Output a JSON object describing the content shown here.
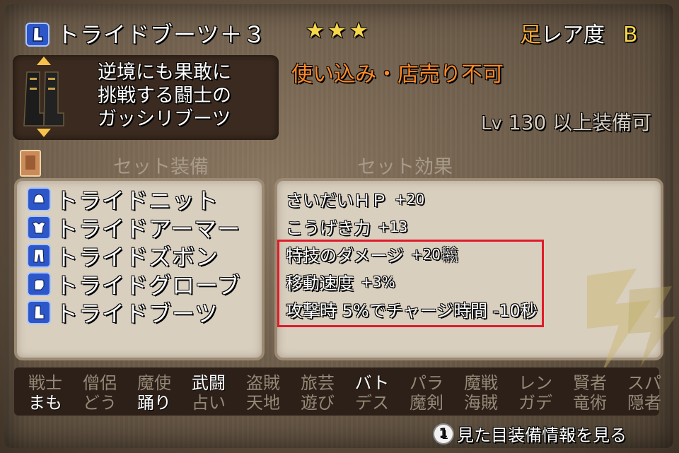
{
  "header": {
    "item_name": "トライドブーツ＋３",
    "stars": "★★★",
    "rarity_slot": "足",
    "rarity_label": "レア度",
    "rarity_grade": "B"
  },
  "description": {
    "line1": "逆境にも果敢に",
    "line2": "挑戦する闘士の",
    "line3": "ガッシリブーツ"
  },
  "restriction": "使い込み・店売り不可",
  "level": {
    "prefix": "Lv",
    "value": "130",
    "suffix": "以上装備可"
  },
  "set_section": {
    "equip_title": "セット装備",
    "effect_title": "セット効果"
  },
  "set_items": [
    {
      "label": "トライドニット",
      "icon": "helmet-icon"
    },
    {
      "label": "トライドアーマー",
      "icon": "armor-icon"
    },
    {
      "label": "トライドズボン",
      "icon": "pants-icon"
    },
    {
      "label": "トライドグローブ",
      "icon": "glove-icon"
    },
    {
      "label": "トライドブーツ",
      "icon": "boots-icon"
    }
  ],
  "set_effects": [
    {
      "text": "さいだいＨＰ",
      "value": "+20"
    },
    {
      "text": "こうげき力",
      "value": "+13"
    },
    {
      "text": "特技のダメージ",
      "value": "+20",
      "tiny1": "鉱合",
      "tiny2": "特効"
    },
    {
      "text": "移動速度",
      "value": "+3%"
    },
    {
      "text": "攻撃時 5%でチャージ時間 -10秒",
      "value": ""
    }
  ],
  "jobs_row1": [
    "戦士",
    "僧侶",
    "魔使",
    "武闘",
    "盗賊",
    "旅芸",
    "バト",
    "パラ",
    "魔戦",
    "レン",
    "賢者",
    "スパ"
  ],
  "jobs_row2": [
    "まも",
    "どう",
    "踊り",
    "占い",
    "天地",
    "遊び",
    "デス",
    "魔剣",
    "海賊",
    "ガデ",
    "竜術",
    "隠者"
  ],
  "jobs_row1_lit": [
    false,
    false,
    false,
    true,
    false,
    false,
    true,
    false,
    false,
    false,
    false,
    false
  ],
  "jobs_row2_lit": [
    true,
    false,
    true,
    false,
    false,
    false,
    false,
    false,
    false,
    false,
    false,
    false
  ],
  "footer": {
    "button": "1",
    "label": "見た目装備情報を見る"
  },
  "colors": {
    "accent_orange": "#ff8a2a",
    "star_yellow": "#f6d64a",
    "highlight_red": "#e01b2a",
    "icon_blue": "#2d57c8"
  }
}
